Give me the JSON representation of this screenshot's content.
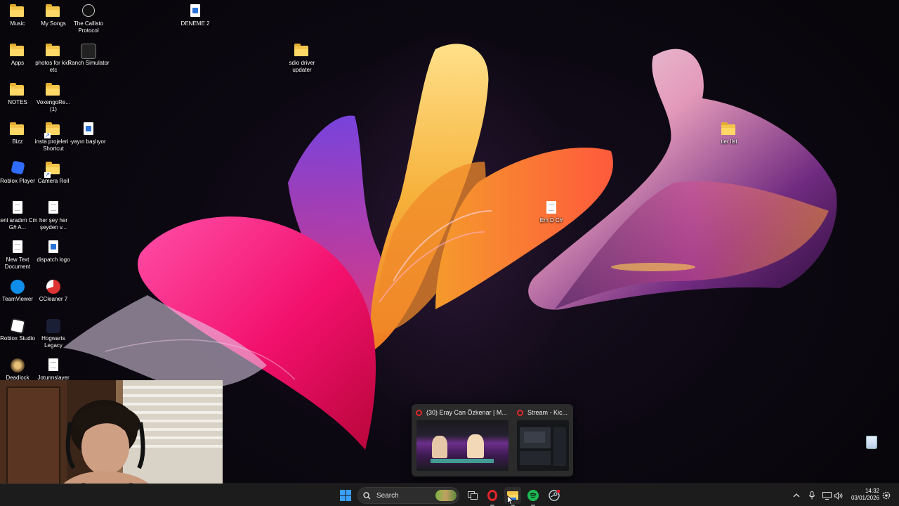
{
  "desktop_icons": [
    {
      "label": "Music"
    },
    {
      "label": "My Songs"
    },
    {
      "label": "The Callisto Protocol"
    },
    {
      "label": "DENEME 2"
    },
    {
      "label": "Apps"
    },
    {
      "label": "photos for kick etc"
    },
    {
      "label": "Ranch Simulator"
    },
    {
      "label": "sdio driver updater"
    },
    {
      "label": "NOTES"
    },
    {
      "label": "VoxengoRe... (1)"
    },
    {
      "label": "Bizz"
    },
    {
      "label": "insta projeleri - Shortcut"
    },
    {
      "label": "yayın başlıyor"
    },
    {
      "label": "tier list"
    },
    {
      "label": "Roblox Player"
    },
    {
      "label": "Camera Roll"
    },
    {
      "label": "Em D C#"
    },
    {
      "label": "seni aradım Cm G# A..."
    },
    {
      "label": "her şey her şeyden v..."
    },
    {
      "label": "New Text Document"
    },
    {
      "label": "dispatch logo"
    },
    {
      "label": "TeamViewer"
    },
    {
      "label": "CCleaner 7"
    },
    {
      "label": "Roblox Studio"
    },
    {
      "label": "Hogwarts Legacy"
    },
    {
      "label": "Deadlock"
    },
    {
      "label": "Jotunnslayer"
    }
  ],
  "preview": {
    "windows": [
      {
        "title": "(30) Eray Can Özkenar | M..."
      },
      {
        "title": "Stream - Kic..."
      }
    ]
  },
  "taskbar": {
    "search_label": "Search",
    "icons": [
      "windows-start-icon",
      "search-icon",
      "task-view-icon",
      "opera-gx-icon",
      "file-explorer-icon",
      "spotify-icon",
      "steam-icon"
    ],
    "tray": {
      "time": "14:32",
      "date": "03/01/2026"
    }
  },
  "colors": {
    "taskbar_bg": "#1c1c1c",
    "folder": "#f4c54b",
    "accent": "#1db954"
  }
}
